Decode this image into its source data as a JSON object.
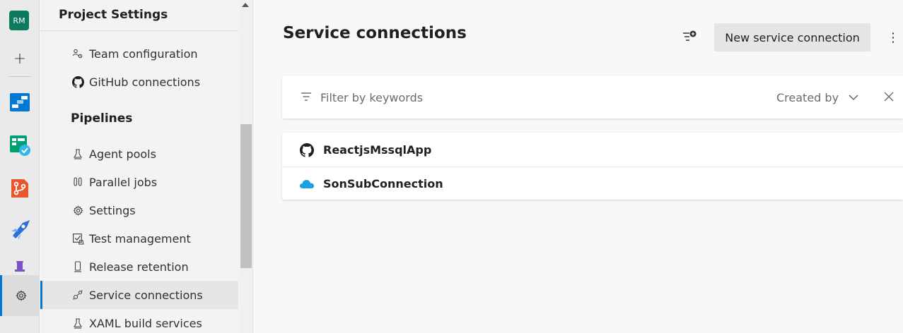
{
  "rail": {
    "avatar_initials": "RM",
    "items": [
      {
        "name": "boards-icon",
        "color": "#0078d4"
      },
      {
        "name": "boards-check-icon",
        "color": "#009e73"
      },
      {
        "name": "repos-icon",
        "color": "#e8562b"
      },
      {
        "name": "pipelines-icon",
        "color": "#2a72d9"
      },
      {
        "name": "test-plans-icon",
        "color": "#7b54c4"
      },
      {
        "name": "gear-icon",
        "color": "#333333"
      }
    ]
  },
  "sidebar": {
    "title": "Project Settings",
    "top_items": [
      {
        "label": "Team configuration",
        "icon": "team-config-icon"
      },
      {
        "label": "GitHub connections",
        "icon": "github-icon"
      }
    ],
    "group_label": "Pipelines",
    "pipeline_items": [
      {
        "label": "Agent pools",
        "icon": "agent-pool-icon"
      },
      {
        "label": "Parallel jobs",
        "icon": "parallel-jobs-icon"
      },
      {
        "label": "Settings",
        "icon": "gear-icon"
      },
      {
        "label": "Test management",
        "icon": "test-management-icon"
      },
      {
        "label": "Release retention",
        "icon": "phone-icon"
      },
      {
        "label": "Service connections",
        "icon": "plug-icon",
        "selected": true
      },
      {
        "label": "XAML build services",
        "icon": "agent-pool-icon"
      }
    ]
  },
  "main": {
    "title": "Service connections",
    "new_button_label": "New service connection",
    "more_label": "⋮",
    "filter": {
      "placeholder": "Filter by keywords",
      "created_by_label": "Created by"
    },
    "connections": [
      {
        "name": "ReactjsMssqlApp",
        "icon": "github-icon"
      },
      {
        "name": "SonSubConnection",
        "icon": "azure-cloud-icon",
        "icon_color": "#1ba1e2"
      }
    ]
  }
}
